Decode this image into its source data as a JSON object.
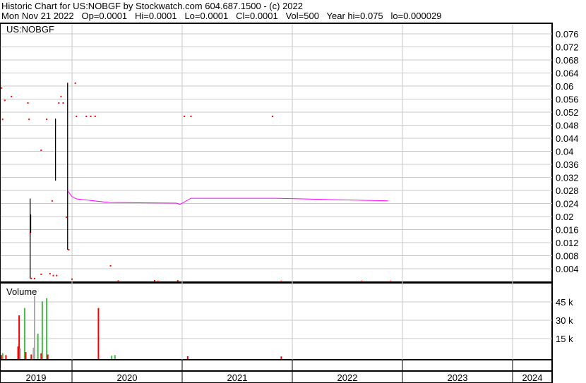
{
  "header": {
    "line1": "Historic Chart for US:NOBGF by Stockwatch.com 604.687.1500 - (c) 2022",
    "line2": "Mon Nov 21 2022   Op=0.0001   Hi=0.0001   Lo=0.0001   Cl=0.0001   Vol=500   Year hi=0.075   lo=0.000029"
  },
  "chart_data": {
    "type": "line",
    "symbol": "US:NOBGF",
    "price_axis": {
      "ticks": [
        "0.076",
        "0.072",
        "0.068",
        "0.064",
        "0.06",
        "0.056",
        "0.052",
        "0.048",
        "0.044",
        "0.04",
        "0.036",
        "0.032",
        "0.028",
        "0.024",
        "0.02",
        "0.016",
        "0.012",
        "0.008",
        "0.004"
      ],
      "ylim": [
        0,
        0.079
      ]
    },
    "volume_label": "Volume",
    "volume_axis": {
      "ticks": [
        "45 k",
        "30 k",
        "15 k"
      ],
      "values": [
        45000,
        30000,
        15000
      ],
      "ylim": [
        0,
        55000
      ]
    },
    "x_axis": {
      "labels": [
        "2019",
        "2020",
        "2021",
        "2022",
        "2023",
        "2024"
      ],
      "xlim": [
        2019.35,
        2024.35
      ]
    },
    "colors": {
      "close": "#ff0000",
      "range": "#000000",
      "ma": "#ff00ff",
      "up": "#44bb44",
      "down": "#ff0000",
      "flat": "#aaaaaa",
      "grid": "#c8c8c8"
    },
    "close_points": [
      [
        2019.36,
        0.0594
      ],
      [
        2019.45,
        0.0568
      ],
      [
        2019.39,
        0.0556
      ],
      [
        2019.6,
        0.0548
      ],
      [
        2019.9,
        0.0568
      ],
      [
        2019.88,
        0.0548
      ],
      [
        2019.92,
        0.0548
      ],
      [
        2019.37,
        0.0498
      ],
      [
        2019.61,
        0.0498
      ],
      [
        2019.77,
        0.0498
      ],
      [
        2019.72,
        0.0403
      ],
      [
        2020.03,
        0.0609
      ],
      [
        2020.04,
        0.0507
      ],
      [
        2020.13,
        0.0507
      ],
      [
        2020.17,
        0.0507
      ],
      [
        2020.21,
        0.0507
      ],
      [
        2019.82,
        0.0248
      ],
      [
        2019.95,
        0.0198
      ],
      [
        2019.62,
        0.0148
      ],
      [
        2019.97,
        0.0098
      ],
      [
        2020.35,
        0.0049
      ],
      [
        2019.63,
        0.001
      ],
      [
        2019.66,
        0.001
      ],
      [
        2019.72,
        0.0023
      ],
      [
        2019.8,
        0.0025
      ],
      [
        2019.83,
        0.0019
      ],
      [
        2019.86,
        0.0019
      ],
      [
        2020.0,
        0.0008
      ],
      [
        2021.02,
        0.0507
      ],
      [
        2021.08,
        0.0507
      ],
      [
        2021.82,
        0.0507
      ],
      [
        2020.42,
        0.0002
      ],
      [
        2020.75,
        0.0003
      ],
      [
        2020.78,
        0.0001
      ],
      [
        2020.96,
        0.0003
      ],
      [
        2021.9,
        0.0001
      ],
      [
        2022.63,
        0.0001
      ],
      [
        2022.89,
        0.0001
      ]
    ],
    "range_bars": [
      [
        2019.62,
        0.001,
        0.0255
      ],
      [
        2019.625,
        0.015,
        0.0206
      ],
      [
        2019.85,
        0.031,
        0.05
      ],
      [
        2019.96,
        0.0098,
        0.061
      ]
    ],
    "moving_average": [
      [
        2019.96,
        0.028
      ],
      [
        2019.99,
        0.0265
      ],
      [
        2020.0,
        0.0261
      ],
      [
        2020.04,
        0.0254
      ],
      [
        2020.34,
        0.0243
      ],
      [
        2020.95,
        0.0241
      ],
      [
        2020.98,
        0.0237
      ],
      [
        2021.08,
        0.0256
      ],
      [
        2021.85,
        0.0256
      ],
      [
        2022.87,
        0.0248
      ]
    ],
    "volume": [
      [
        2019.36,
        1500,
        "down"
      ],
      [
        2019.37,
        3000,
        "up"
      ],
      [
        2019.4,
        1500,
        "down"
      ],
      [
        2019.51,
        8500,
        "down"
      ],
      [
        2019.52,
        34000,
        "down"
      ],
      [
        2019.53,
        7000,
        "flat"
      ],
      [
        2019.57,
        40000,
        "up"
      ],
      [
        2019.58,
        4000,
        "down"
      ],
      [
        2019.63,
        2000,
        "down"
      ],
      [
        2019.65,
        7500,
        "flat"
      ],
      [
        2019.66,
        50000,
        "flat"
      ],
      [
        2019.69,
        19000,
        "up"
      ],
      [
        2019.72,
        3000,
        "down"
      ],
      [
        2019.73,
        45500,
        "up"
      ],
      [
        2019.77,
        48000,
        "up"
      ],
      [
        2019.78,
        2000,
        "down"
      ],
      [
        2020.24,
        40000,
        "down"
      ],
      [
        2020.36,
        1000,
        "up"
      ],
      [
        2020.39,
        1500,
        "up"
      ],
      [
        2021.05,
        600,
        "down"
      ],
      [
        2021.9,
        400,
        "down"
      ]
    ]
  }
}
